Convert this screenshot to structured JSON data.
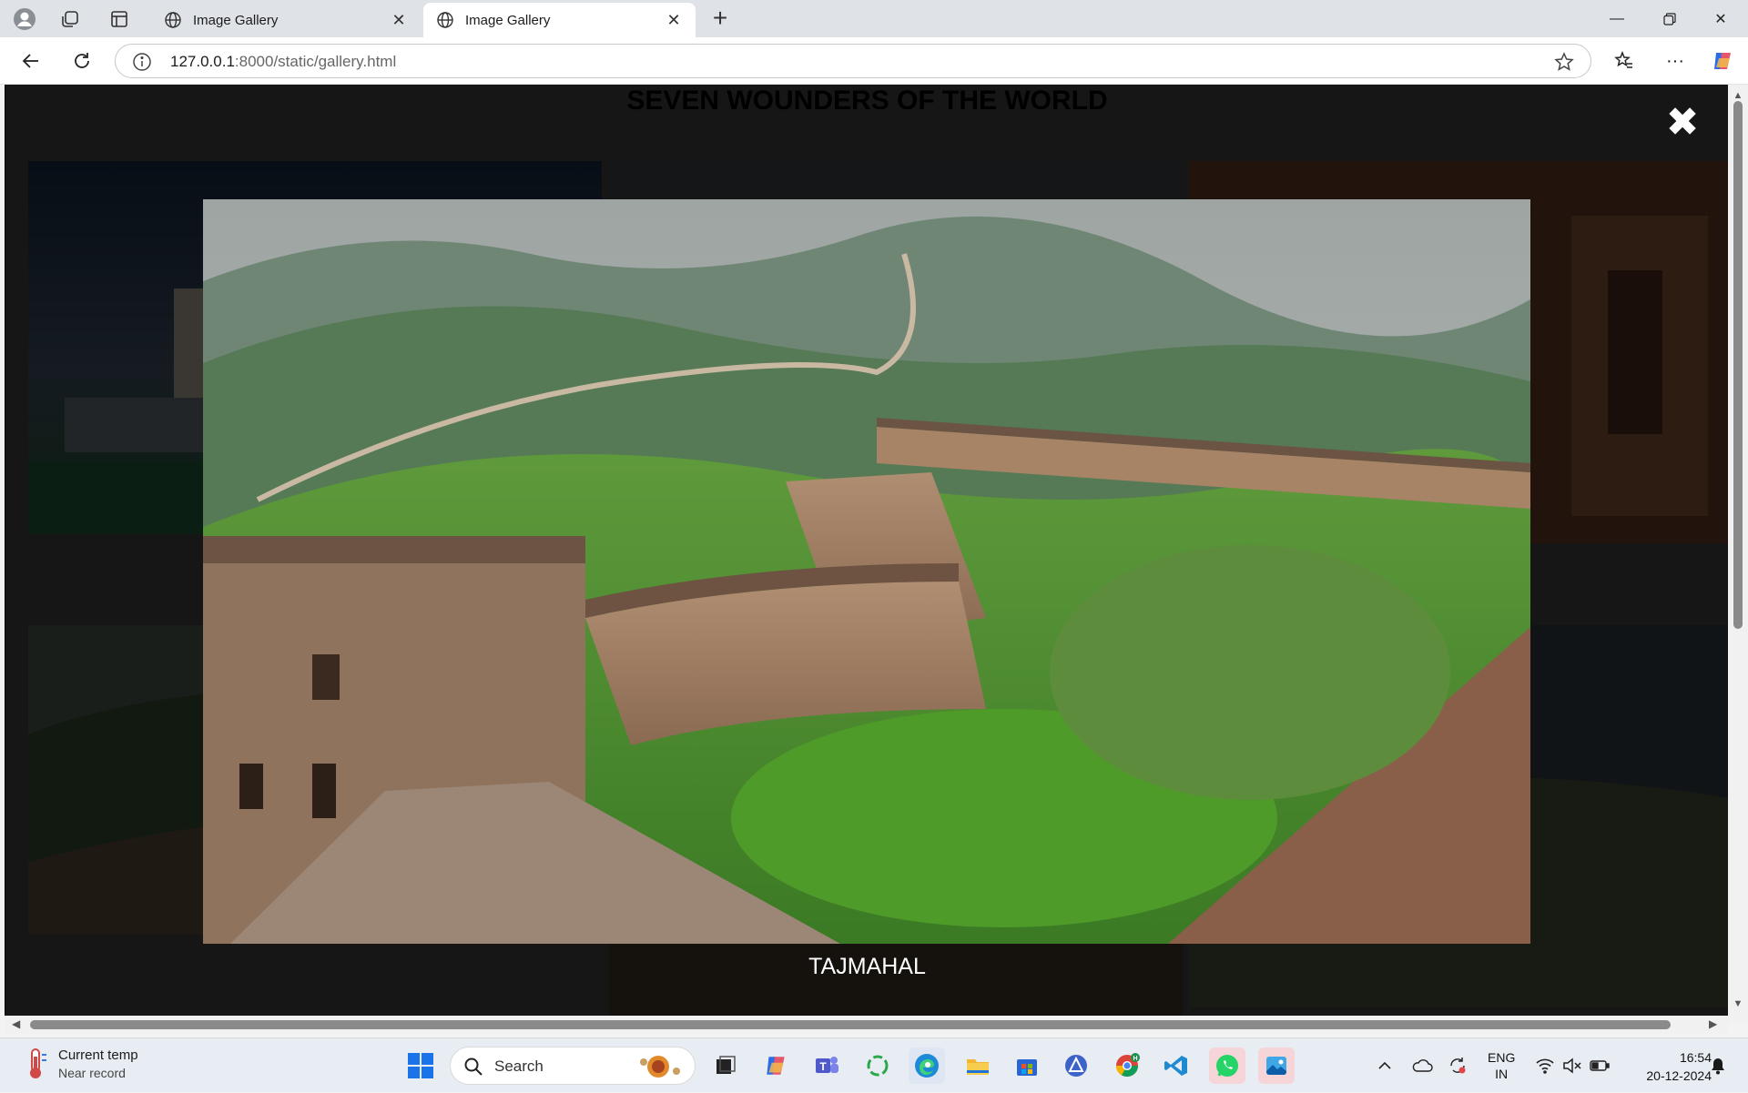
{
  "browser": {
    "tabs": [
      {
        "label": "Image Gallery",
        "active": false
      },
      {
        "label": "Image Gallery",
        "active": true
      }
    ],
    "url_host": "127.0.0.1",
    "url_path": ":8000/static/gallery.html"
  },
  "page": {
    "title": "SEVEN WOUNDERS OF THE WORLD",
    "lightbox_caption": "TAJMAHAL",
    "close_symbol": "✖"
  },
  "taskbar": {
    "weather_title": "Current temp",
    "weather_sub": "Near record",
    "search_label": "Search",
    "lang_line1": "ENG",
    "lang_line2": "IN",
    "time": "16:54",
    "date": "20-12-2024"
  }
}
